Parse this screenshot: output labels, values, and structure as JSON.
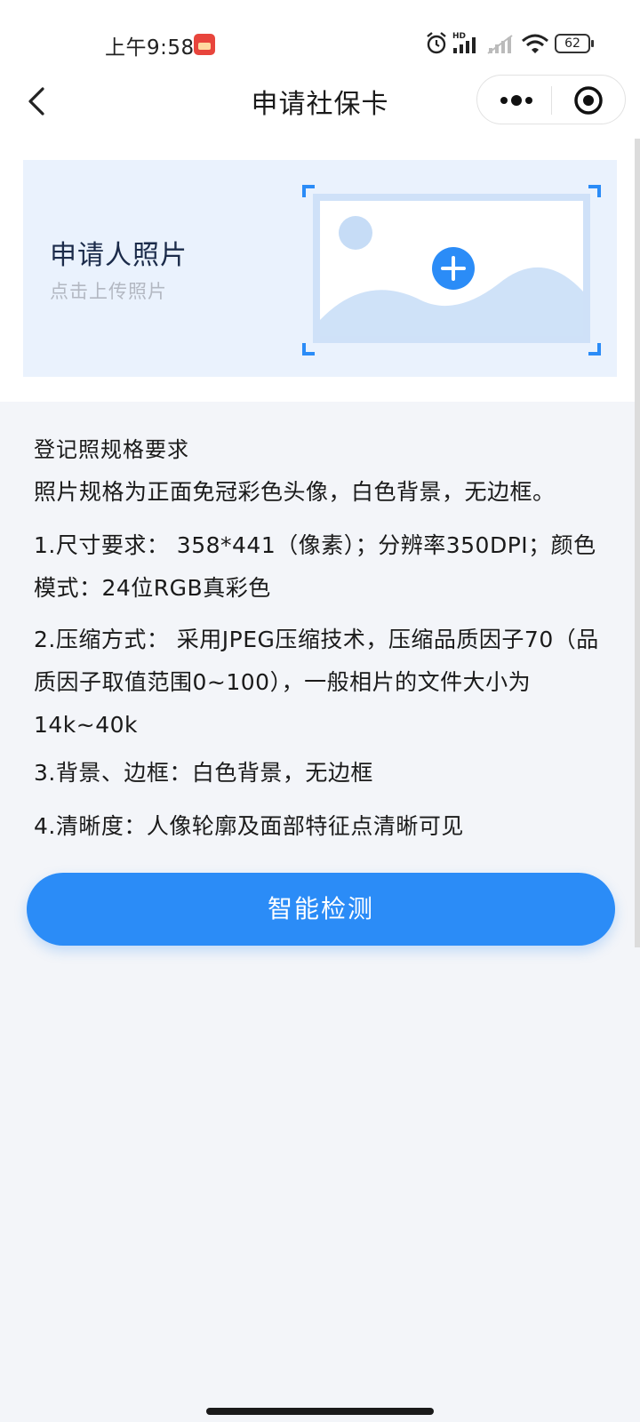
{
  "status_bar": {
    "time": "上午9:58",
    "battery": "62"
  },
  "nav": {
    "title": "申请社保卡"
  },
  "photo_upload": {
    "title": "申请人照片",
    "subtitle": "点击上传照片"
  },
  "spec": {
    "heading": "登记照规格要求",
    "intro": "照片规格为正面免冠彩色头像，白色背景，无边框。",
    "item1": "1.尺寸要求： 358*441（像素）；分辨率350DPI；颜色模式：24位RGB真彩色",
    "item2": "2.压缩方式： 采用JPEG压缩技术，压缩品质因子70（品质因子取值范围0~100），一般相片的文件大小为14k~40k",
    "item3": "3.背景、边框：白色背景，无边框",
    "item4": "4.清晰度：人像轮廓及面部特征点清晰可见"
  },
  "actions": {
    "detect_label": "智能检测"
  },
  "colors": {
    "accent": "#2b8cf7",
    "panel_bg": "#eaf2fd",
    "page_bg": "#f3f5f9"
  },
  "icons": {
    "back": "chevron-left-icon",
    "more": "more-dots-icon",
    "close": "target-circle-icon",
    "upload": "image-plus-icon",
    "alarm": "alarm-icon",
    "signal": "signal-icon",
    "wifi": "wifi-icon",
    "battery": "battery-icon"
  }
}
